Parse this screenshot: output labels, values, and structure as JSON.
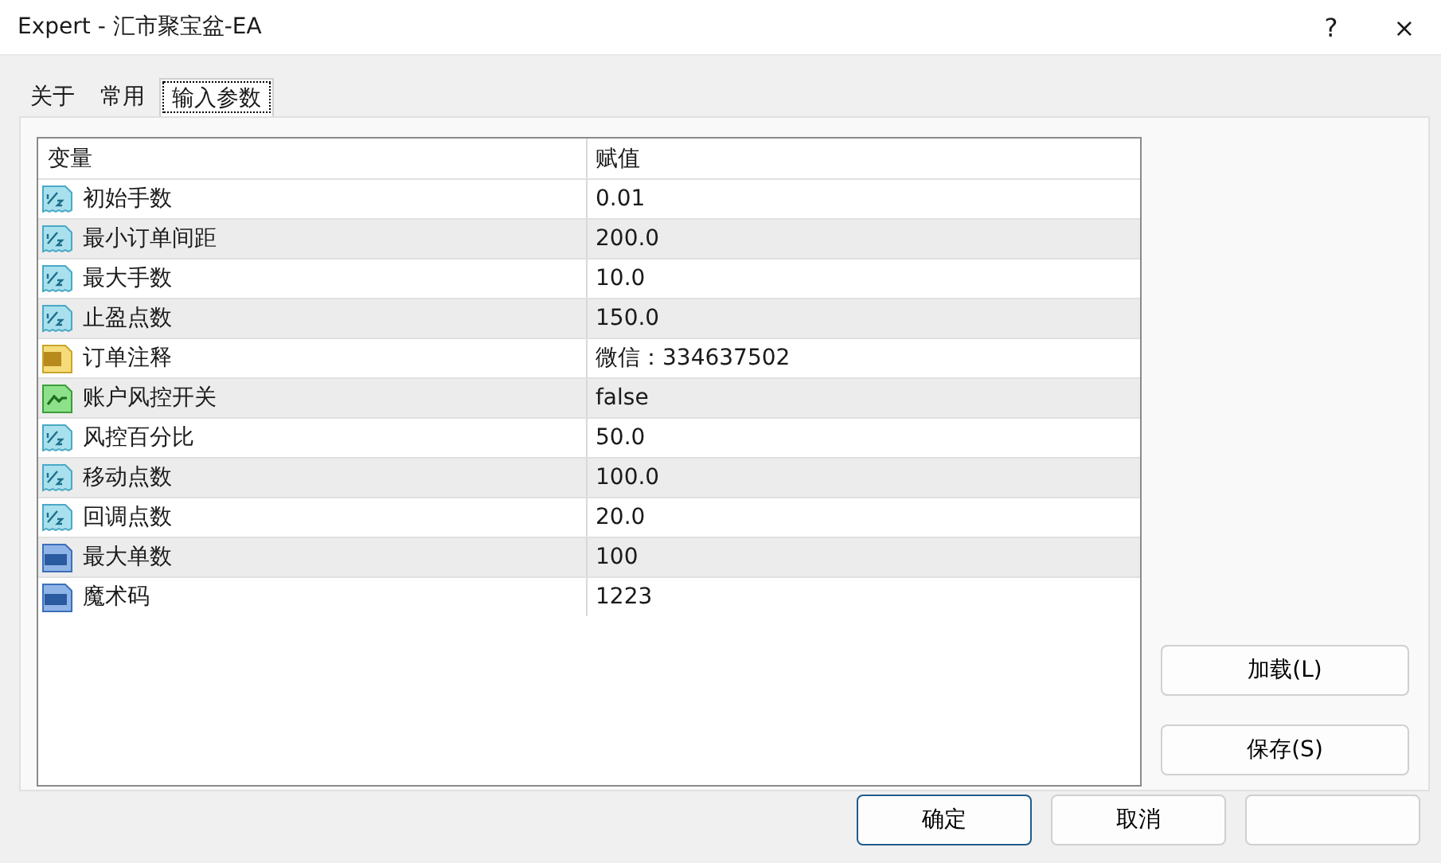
{
  "window": {
    "title": "Expert - 汇市聚宝盆-EA",
    "help": "?",
    "close": "×"
  },
  "tabs": [
    {
      "label": "关于",
      "selected": false
    },
    {
      "label": "常用",
      "selected": false
    },
    {
      "label": "输入参数",
      "selected": true
    }
  ],
  "table": {
    "columns": [
      "变量",
      "赋值"
    ],
    "rows": [
      {
        "kind": "double",
        "name": "初始手数",
        "value": "0.01"
      },
      {
        "kind": "double",
        "name": "最小订单间距",
        "value": "200.0"
      },
      {
        "kind": "double",
        "name": "最大手数",
        "value": "10.0"
      },
      {
        "kind": "double",
        "name": "止盈点数",
        "value": "150.0"
      },
      {
        "kind": "string",
        "name": "订单注释",
        "value": "微信：334637502"
      },
      {
        "kind": "bool",
        "name": "账户风控开关",
        "value": "false"
      },
      {
        "kind": "double",
        "name": "风控百分比",
        "value": "50.0"
      },
      {
        "kind": "double",
        "name": "移动点数",
        "value": "100.0"
      },
      {
        "kind": "double",
        "name": "回调点数",
        "value": "20.0"
      },
      {
        "kind": "int",
        "name": "最大单数",
        "value": "100"
      },
      {
        "kind": "int",
        "name": "魔术码",
        "value": "1223"
      }
    ]
  },
  "side_buttons": [
    "加载(L)",
    "保存(S)"
  ],
  "buttons": [
    {
      "label": "确定",
      "default": true
    },
    {
      "label": "取消",
      "default": false
    },
    {
      "default": false
    }
  ]
}
